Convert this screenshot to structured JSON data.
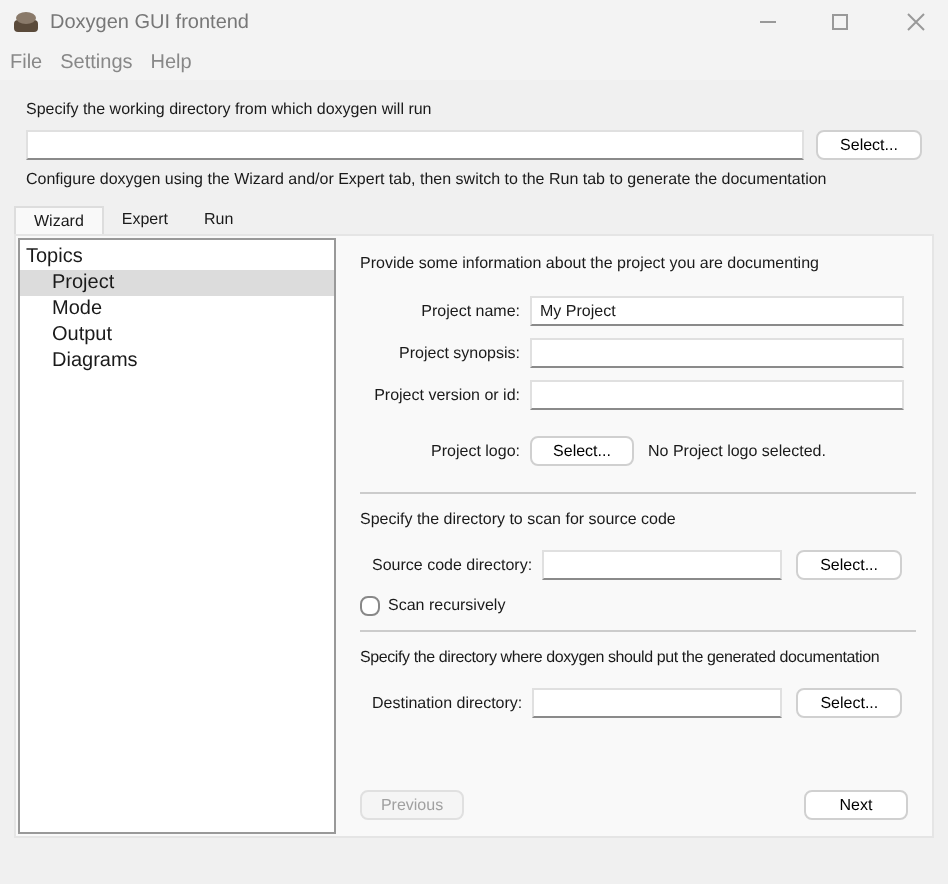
{
  "window": {
    "title": "Doxygen GUI frontend"
  },
  "menu": [
    "File",
    "Settings",
    "Help"
  ],
  "working_dir": {
    "label": "Specify the working directory from which doxygen will run",
    "button": "Select..."
  },
  "hint": "Configure doxygen using the Wizard and/or Expert tab, then switch to the Run tab to generate the documentation",
  "tabs": [
    {
      "label": "Wizard",
      "selected": true
    },
    {
      "label": "Expert",
      "selected": false
    },
    {
      "label": "Run",
      "selected": false
    }
  ],
  "topics": {
    "title": "Topics",
    "items": [
      {
        "label": "Project",
        "selected": true
      },
      {
        "label": "Mode",
        "selected": false
      },
      {
        "label": "Output",
        "selected": false
      },
      {
        "label": "Diagrams",
        "selected": false
      }
    ]
  },
  "project": {
    "heading": "Provide some information about the project you are documenting",
    "fields": [
      {
        "label": "Project name:",
        "value": "My Project"
      },
      {
        "label": "Project synopsis:"
      },
      {
        "label": "Project version or id:"
      }
    ],
    "logo": {
      "label": "Project logo:",
      "button": "Select...",
      "status": "No Project logo selected."
    }
  },
  "source": {
    "heading": "Specify the directory to scan for source code",
    "label": "Source code directory:",
    "button": "Select...",
    "checkbox": {
      "label": "Scan recursively",
      "checked": false
    }
  },
  "destination": {
    "heading": "Specify the directory where doxygen should put the generated documentation",
    "label": "Destination directory:",
    "button": "Select..."
  },
  "nav": [
    {
      "label": "Previous",
      "disabled": true
    },
    {
      "label": "Next",
      "disabled": false
    }
  ]
}
